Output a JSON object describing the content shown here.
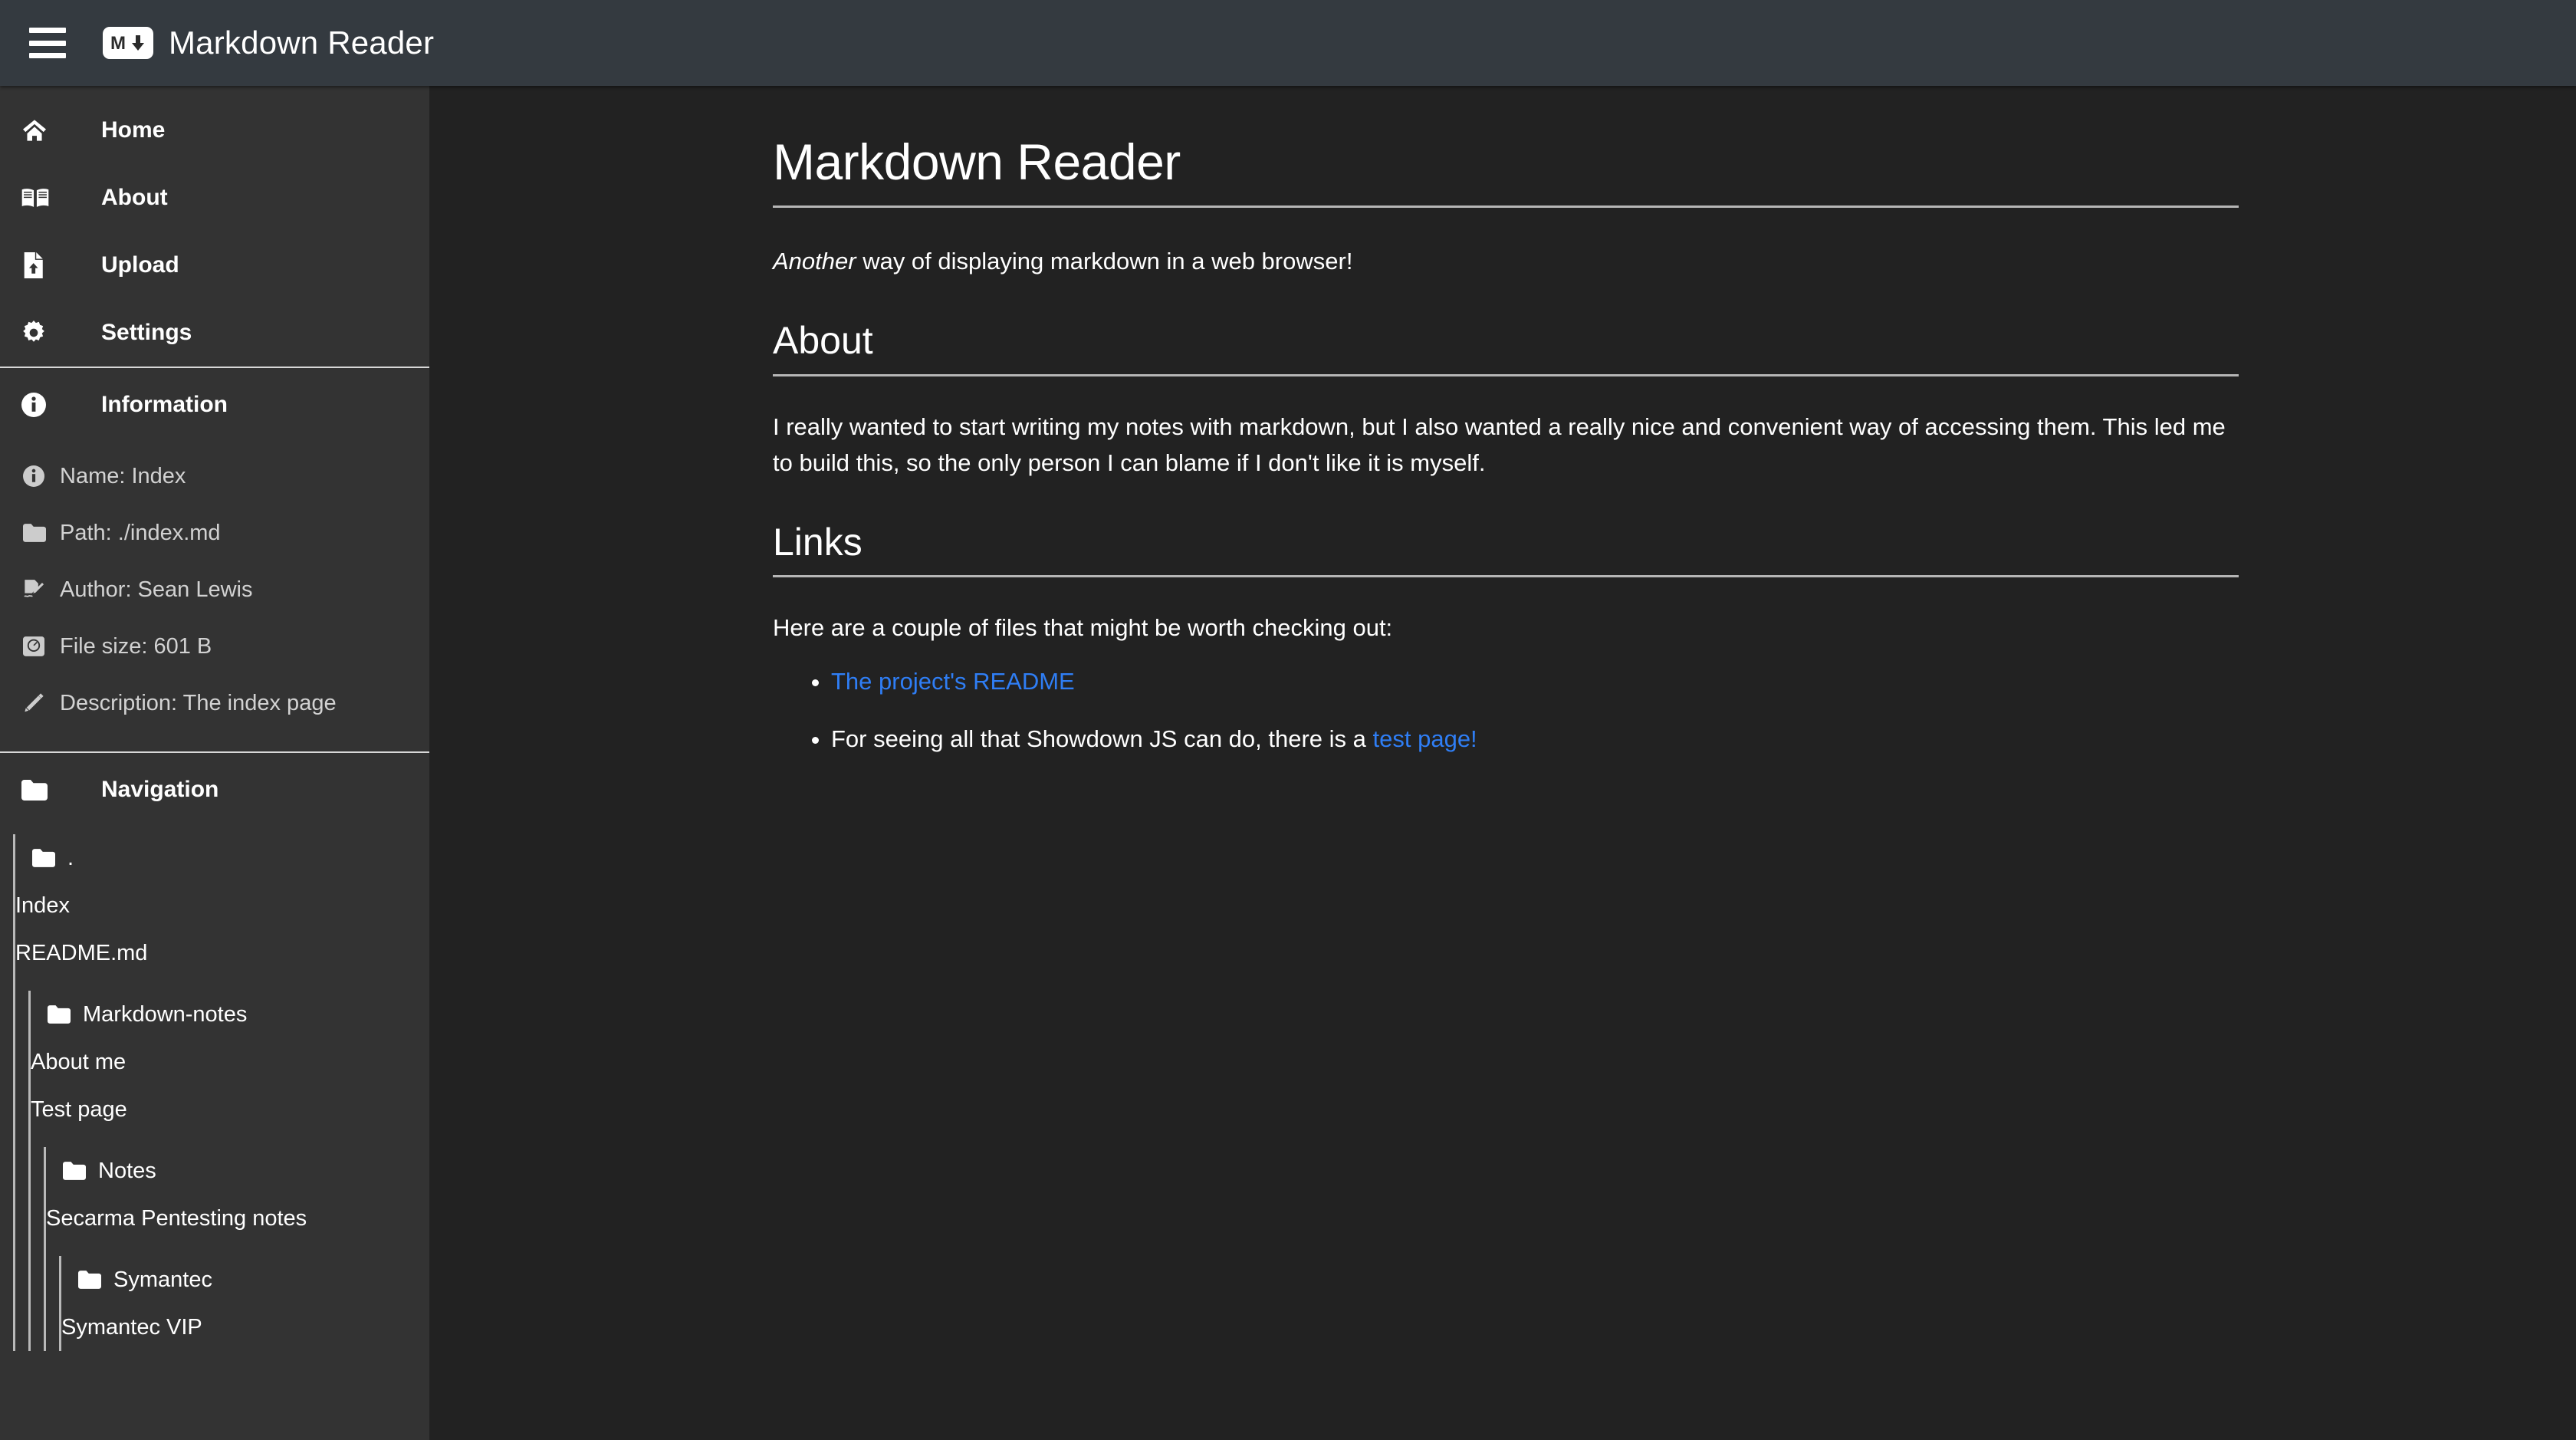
{
  "header": {
    "menu_icon": "hamburger-icon",
    "logo_icon": "markdown-logo-icon",
    "title": "Markdown Reader"
  },
  "sidebar": {
    "nav_items": [
      {
        "icon": "home-icon",
        "label": "Home"
      },
      {
        "icon": "book-open-icon",
        "label": "About"
      },
      {
        "icon": "file-upload-icon",
        "label": "Upload"
      },
      {
        "icon": "gear-icon",
        "label": "Settings"
      }
    ],
    "information": {
      "icon": "info-circle-icon",
      "heading": "Information",
      "rows": [
        {
          "icon": "info-circle-icon",
          "text": "Name: Index"
        },
        {
          "icon": "folder-icon",
          "text": "Path: ./index.md"
        },
        {
          "icon": "file-signature-icon",
          "text": "Author: Sean Lewis"
        },
        {
          "icon": "weight-scale-icon",
          "text": "File size: 601 B"
        },
        {
          "icon": "pen-icon",
          "text": "Description: The index page"
        }
      ]
    },
    "navigation": {
      "icon": "folder-icon",
      "heading": "Navigation",
      "tree": {
        "root_folder": ".",
        "root_files": [
          "Index",
          "README.md"
        ],
        "markdown_notes_folder": "Markdown-notes",
        "markdown_notes_files": [
          "About me",
          "Test page"
        ],
        "notes_folder": "Notes",
        "notes_files": [
          "Secarma Pentesting notes"
        ],
        "symantec_folder": "Symantec",
        "symantec_files": [
          "Symantec VIP"
        ]
      }
    }
  },
  "document": {
    "title": "Markdown Reader",
    "tagline_em": "Another",
    "tagline_rest": " way of displaying markdown in a web browser!",
    "about_heading": "About",
    "about_paragraph": "I really wanted to start writing my notes with markdown, but I also wanted a really nice and convenient way of accessing them. This led me to build this, so the only person I can blame if I don't like it is myself.",
    "links_heading": "Links",
    "links_intro": "Here are a couple of files that might be worth checking out:",
    "link_item_1": "The project's README",
    "link_item_2_prefix": "For seeing all that Showdown JS can do, there is a ",
    "link_item_2_link": "test page!"
  },
  "colors": {
    "header_bg": "#343a40",
    "sidebar_bg": "#333333",
    "content_bg": "#222222",
    "link": "#2f7ef5",
    "rule": "#b6b6b6"
  }
}
